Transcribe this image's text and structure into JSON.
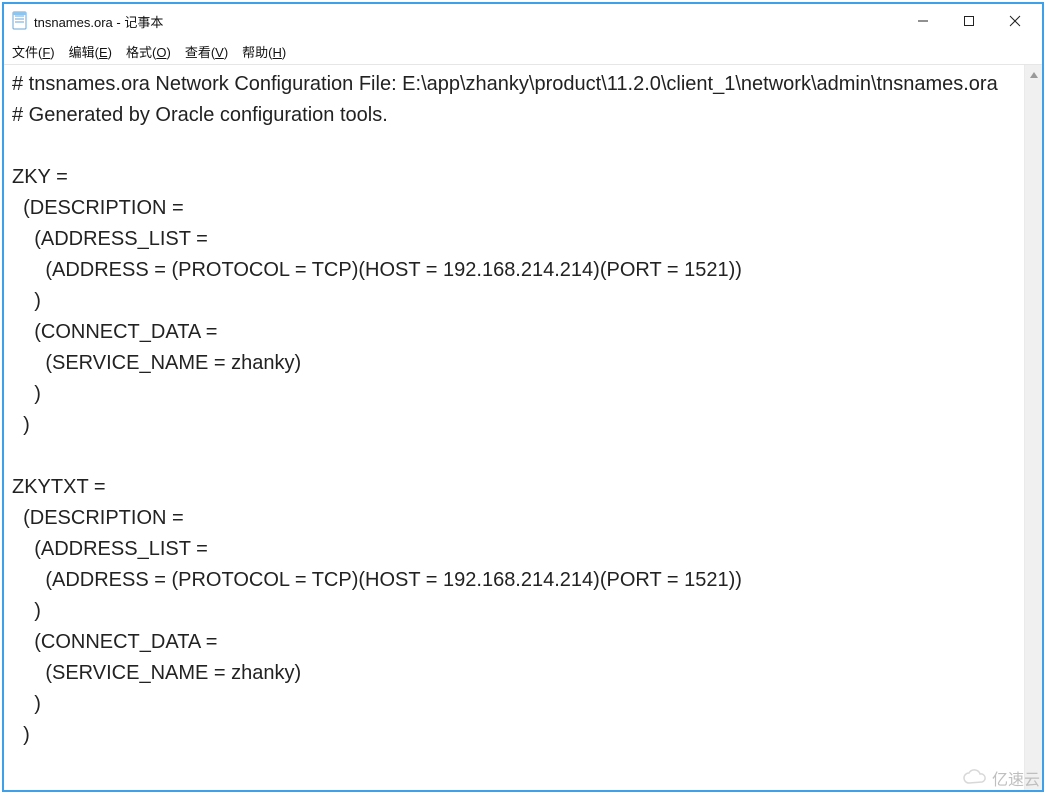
{
  "window": {
    "title": "tnsnames.ora - 记事本"
  },
  "menu": {
    "file": "文件(F)",
    "edit": "编辑(E)",
    "format": "格式(O)",
    "view": "查看(V)",
    "help": "帮助(H)"
  },
  "content": "# tnsnames.ora Network Configuration File: E:\\app\\zhanky\\product\\11.2.0\\client_1\\network\\admin\\tnsnames.ora\n# Generated by Oracle configuration tools.\n\nZKY =\n  (DESCRIPTION =\n    (ADDRESS_LIST =\n      (ADDRESS = (PROTOCOL = TCP)(HOST = 192.168.214.214)(PORT = 1521))\n    )\n    (CONNECT_DATA =\n      (SERVICE_NAME = zhanky)\n    )\n  )\n\nZKYTXT =\n  (DESCRIPTION =\n    (ADDRESS_LIST =\n      (ADDRESS = (PROTOCOL = TCP)(HOST = 192.168.214.214)(PORT = 1521))\n    )\n    (CONNECT_DATA =\n      (SERVICE_NAME = zhanky)\n    )\n  )",
  "watermark": "亿速云"
}
